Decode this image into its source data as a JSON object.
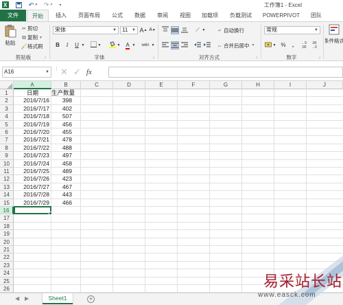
{
  "title_bar": {
    "title": "工作簿1 - Excel",
    "quick_access": [
      "excel-logo-icon",
      "save-icon",
      "undo-icon",
      "redo-icon",
      "customize-icon"
    ]
  },
  "ribbon_tabs": {
    "file": "文件",
    "items": [
      "开始",
      "插入",
      "页面布局",
      "公式",
      "数据",
      "审阅",
      "视图",
      "加载项",
      "负载测试",
      "POWERPIVOT",
      "团队"
    ],
    "active": "开始"
  },
  "ribbon": {
    "clipboard": {
      "label": "剪贴板",
      "paste": "粘贴",
      "cut": "剪切",
      "copy": "复制",
      "format_painter": "格式刷"
    },
    "font": {
      "label": "字体",
      "font_name": "宋体",
      "font_size": "11",
      "bold": "B",
      "italic": "I",
      "underline": "U",
      "grow": "A",
      "shrink": "A",
      "font_color_letter": "A",
      "wen": "wén"
    },
    "alignment": {
      "label": "对齐方式",
      "wrap_text": "自动换行",
      "merge_center": "合并后居中"
    },
    "number": {
      "label": "数字",
      "format": "常规",
      "percent": "%",
      "comma": ","
    },
    "styles": {
      "conditional": "条件格式"
    }
  },
  "formula_bar": {
    "name_box": "A16",
    "fx": "fx",
    "formula": ""
  },
  "grid": {
    "columns": [
      "A",
      "B",
      "C",
      "D",
      "E",
      "F",
      "G",
      "H",
      "I",
      "J"
    ],
    "rows": [
      "1",
      "2",
      "3",
      "4",
      "5",
      "6",
      "7",
      "8",
      "9",
      "10",
      "11",
      "12",
      "13",
      "14",
      "15",
      "16",
      "17",
      "18",
      "19",
      "20",
      "21",
      "22",
      "23",
      "24",
      "25",
      "26"
    ],
    "header": [
      "日期",
      "生产数量"
    ],
    "data": [
      [
        "2016/7/16",
        "398"
      ],
      [
        "2016/7/17",
        "402"
      ],
      [
        "2016/7/18",
        "507"
      ],
      [
        "2016/7/19",
        "456"
      ],
      [
        "2016/7/20",
        "455"
      ],
      [
        "2016/7/21",
        "478"
      ],
      [
        "2016/7/22",
        "488"
      ],
      [
        "2016/7/23",
        "497"
      ],
      [
        "2016/7/24",
        "458"
      ],
      [
        "2016/7/25",
        "489"
      ],
      [
        "2016/7/26",
        "423"
      ],
      [
        "2016/7/27",
        "467"
      ],
      [
        "2016/7/28",
        "443"
      ],
      [
        "2016/7/29",
        "466"
      ]
    ],
    "selected_cell": "A16"
  },
  "sheet_tabs": {
    "sheets": [
      "Sheet1"
    ],
    "active": "Sheet1",
    "add": "+"
  },
  "watermark": {
    "text": "易采站长站",
    "url": "www.easck.com"
  },
  "colors": {
    "accent": "#217346",
    "ribbon_bg": "#f3f3f3",
    "watermark_red": "#a41e2c"
  }
}
